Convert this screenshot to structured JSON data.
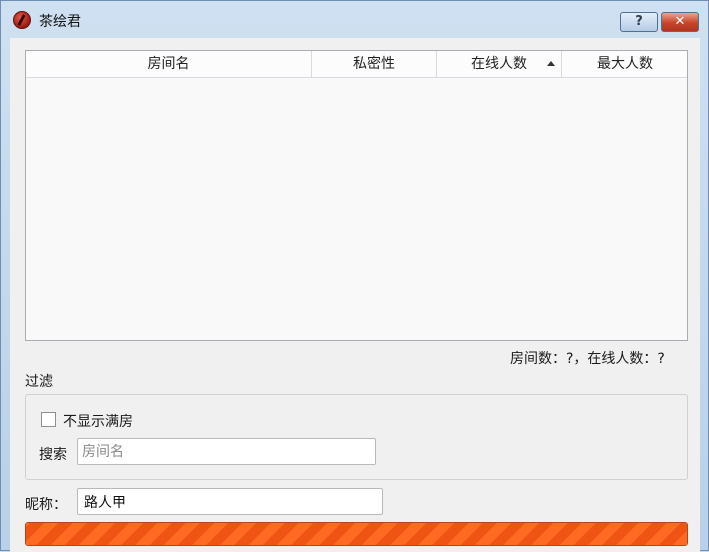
{
  "window": {
    "title": "茶绘君",
    "help_label": "?",
    "close_label": "✕"
  },
  "room_table": {
    "columns": [
      {
        "label": "房间名"
      },
      {
        "label": "私密性"
      },
      {
        "label": "在线人数",
        "sorted": "ascending"
      },
      {
        "label": "最大人数"
      }
    ],
    "rows": []
  },
  "stats": {
    "text": "房间数：?，在线人数：?"
  },
  "filter": {
    "title": "过滤",
    "hide_full_label": "不显示满房",
    "hide_full_checked": false,
    "search_label": "搜索",
    "search_placeholder": "房间名",
    "search_value": ""
  },
  "nickname": {
    "label": "昵称：",
    "value": "路人甲"
  },
  "progress": {
    "fraction": 1.0
  },
  "colors": {
    "progress_accent": "#ff6a22",
    "title_bar": "#cfe0f1",
    "close_button": "#c8442a"
  }
}
